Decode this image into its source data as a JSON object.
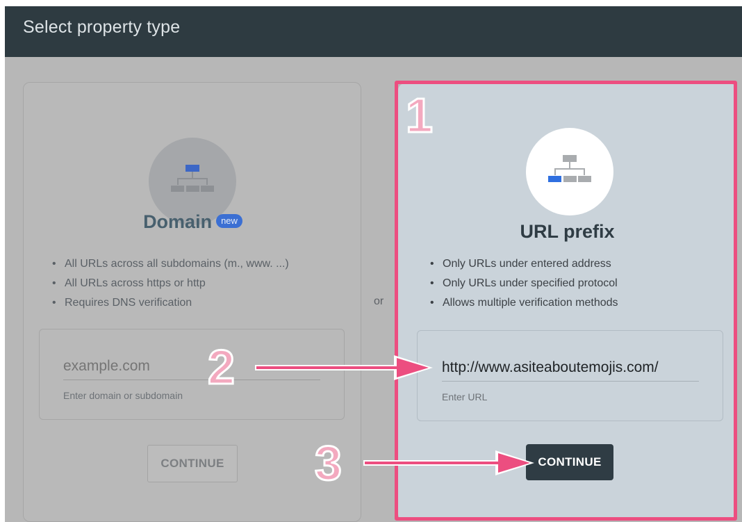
{
  "header": {
    "title": "Select property type"
  },
  "domain_card": {
    "title": "Domain",
    "badge": "new",
    "bullets": [
      "All URLs across all subdomains (m., www. ...)",
      "All URLs across https or http",
      "Requires DNS verification"
    ],
    "input_placeholder": "example.com",
    "input_value": "",
    "helper": "Enter domain or subdomain",
    "button_label": "CONTINUE"
  },
  "separator": {
    "label": "or"
  },
  "url_card": {
    "title": "URL prefix",
    "bullets": [
      "Only URLs under entered address",
      "Only URLs under specified protocol",
      "Allows multiple verification methods"
    ],
    "input_value": "http://www.asiteaboutemojis.com/",
    "helper": "Enter URL",
    "button_label": "CONTINUE"
  },
  "annotations": {
    "step1": "1",
    "step2": "2",
    "step3": "3"
  },
  "colors": {
    "header_bg": "#2e3b41",
    "highlight": "#ec4e80",
    "accent_blue": "#3b6fd3",
    "primary_button": "#2f3c44"
  },
  "icons": {
    "domain": "sitemap-icon",
    "url_prefix": "sitemap-icon"
  }
}
